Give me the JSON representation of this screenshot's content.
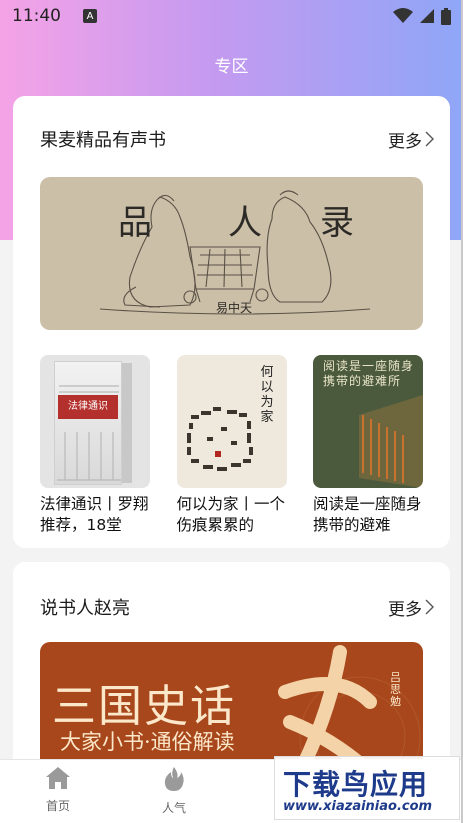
{
  "status_bar": {
    "time": "11:40",
    "notification_icon": "A"
  },
  "page": {
    "title": "专区"
  },
  "section1": {
    "title": "果麦精品有声书",
    "more": "更多",
    "banner": {
      "char1": "品",
      "char2": "人",
      "char3": "录",
      "author": "易中天"
    },
    "books": [
      {
        "title": "法律通识丨罗翔推荐，18堂",
        "cover_text": "法律通识"
      },
      {
        "title": "何以为家丨一个伤痕累累的",
        "cover_text": "何以为家"
      },
      {
        "title": "阅读是一座随身携带的避难",
        "cover_text": "阅读是一座随身携带的避难所"
      }
    ]
  },
  "section2": {
    "title": "说书人赵亮",
    "more": "更多",
    "banner": {
      "title": "三国史话",
      "subtitle": "大家小书·通俗解读",
      "author": "吕思勉"
    }
  },
  "tabbar": {
    "tabs": [
      {
        "label": "首页",
        "icon": "home-icon"
      },
      {
        "label": "人气",
        "icon": "flame-icon"
      }
    ]
  },
  "watermark": {
    "line1": "下载鸟应用",
    "line2": "www.xiazainiao.com"
  },
  "colors": {
    "gradient_start": "#f5a3e6",
    "gradient_end": "#8fa6f7",
    "card_bg": "#ffffff"
  }
}
